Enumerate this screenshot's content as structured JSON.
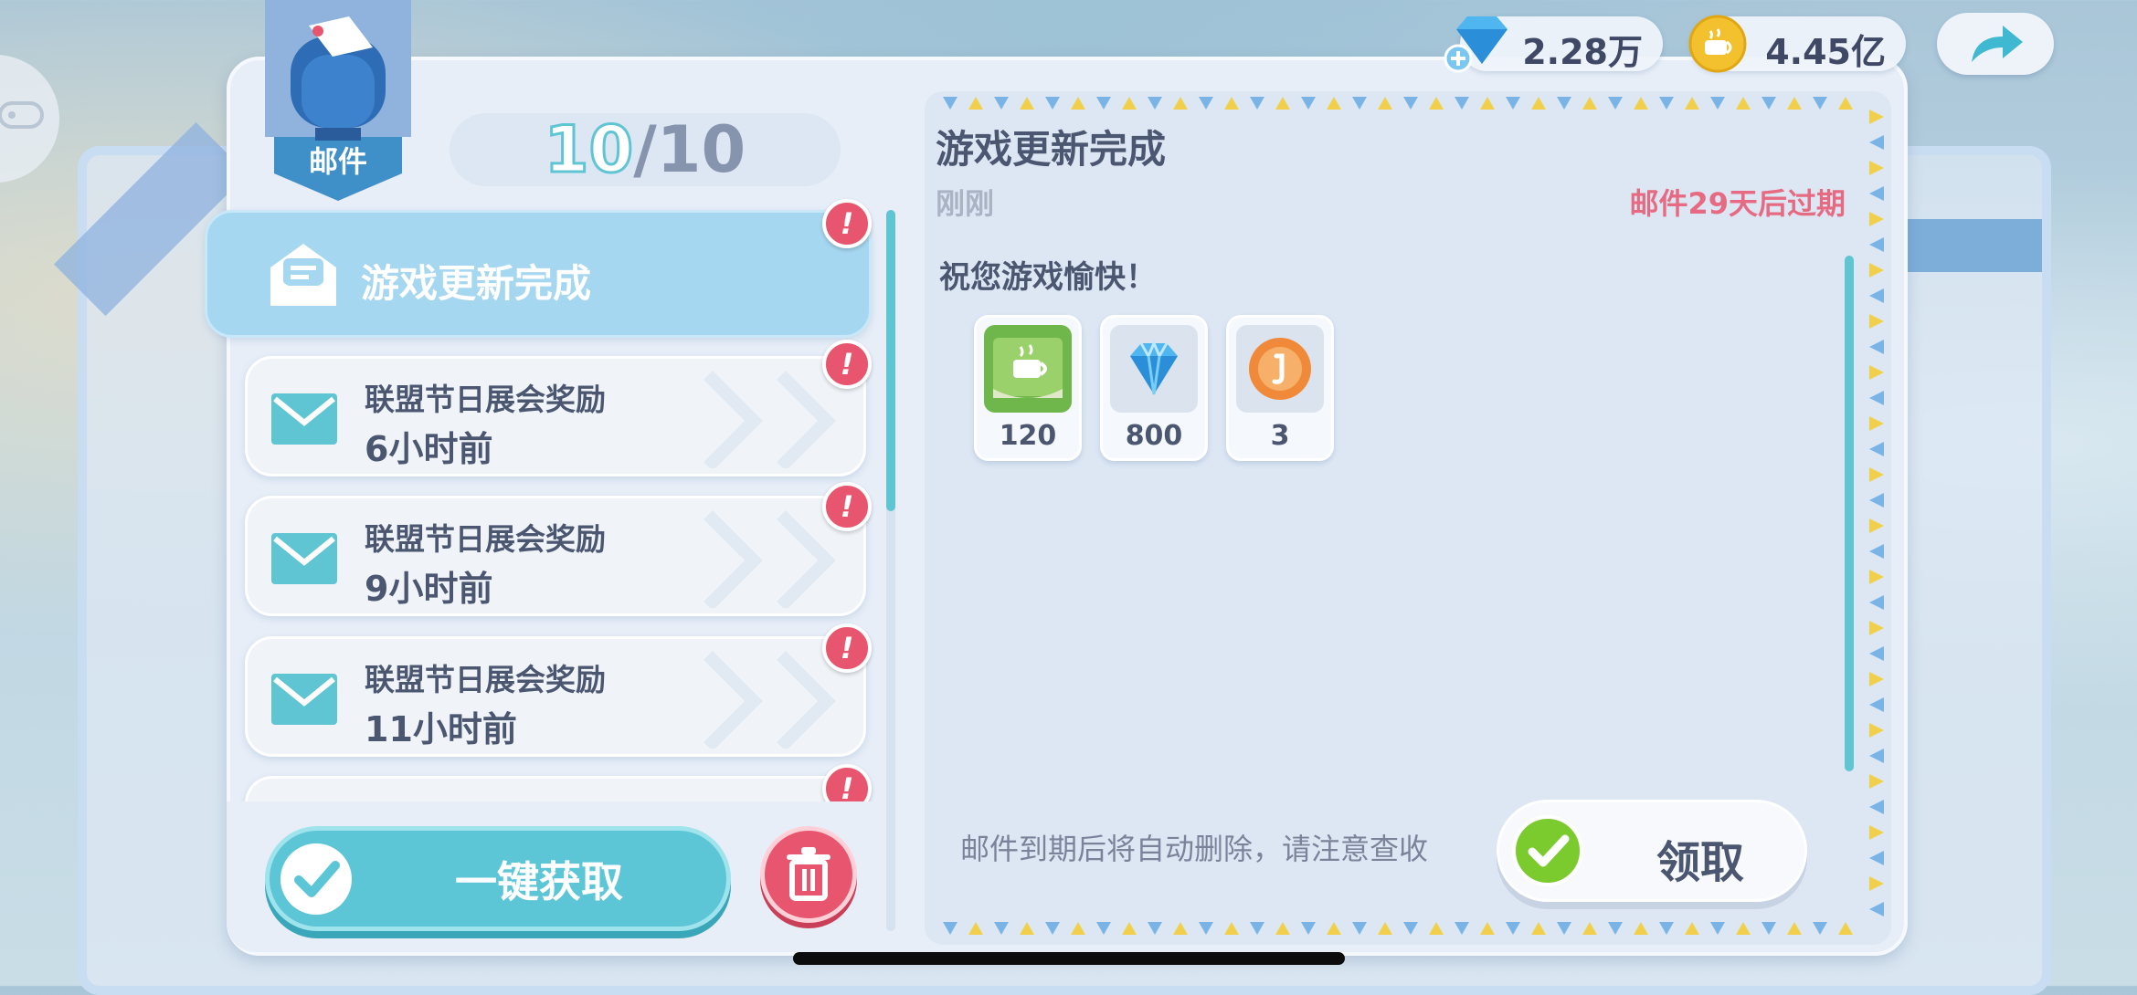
{
  "currency": {
    "diamonds": "2.28万",
    "coins": "4.45亿"
  },
  "mailbox": {
    "label": "邮件",
    "icon": "mailbox-icon"
  },
  "counter": {
    "current": "10",
    "total": "/10"
  },
  "mail_list": [
    {
      "title": "游戏更新完成",
      "time": "",
      "active": true,
      "unread_badge": "!"
    },
    {
      "title": "联盟节日展会奖励",
      "time": "6小时前",
      "active": false,
      "unread_badge": "!"
    },
    {
      "title": "联盟节日展会奖励",
      "time": "9小时前",
      "active": false,
      "unread_badge": "!"
    },
    {
      "title": "联盟节日展会奖励",
      "time": "11小时前",
      "active": false,
      "unread_badge": "!"
    },
    {
      "title": "",
      "time": "",
      "active": false,
      "unread_badge": "!"
    }
  ],
  "actions": {
    "claim_all": "一键获取",
    "delete_icon": "trash-icon"
  },
  "detail": {
    "title": "游戏更新完成",
    "time": "刚刚",
    "expire": "邮件29天后过期",
    "body": "祝您游戏愉快！",
    "rewards": [
      {
        "icon": "green-ticket-icon",
        "qty": "120"
      },
      {
        "icon": "diamond-icon",
        "qty": "800"
      },
      {
        "icon": "orange-token-icon",
        "qty": "3"
      }
    ],
    "notice": "邮件到期后将自动删除，请注意查收",
    "claim_label": "领取"
  },
  "colors": {
    "accent": "#5fc5d3",
    "alert": "#e8556e",
    "text": "#4b5670",
    "expire": "#e66a82",
    "claim_check": "#7ccb2e"
  }
}
